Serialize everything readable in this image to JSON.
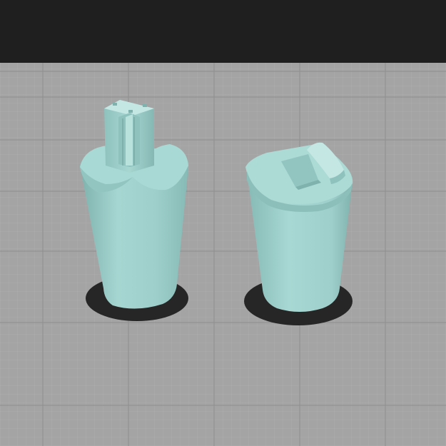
{
  "viewport": {
    "background_color": "#1f1f1f",
    "bed_color": "#a4a4a4",
    "grid_minor_color": "#b3b3b3",
    "grid_major_color": "#8e8e8e",
    "model_color": "#9fcfcb",
    "model_shade_color": "#7fb2ad",
    "model_highlight_color": "#c4e7e3",
    "shadow_color": "#262626"
  },
  "models": [
    {
      "name": "part-with-peg"
    },
    {
      "name": "part-with-slot"
    }
  ]
}
